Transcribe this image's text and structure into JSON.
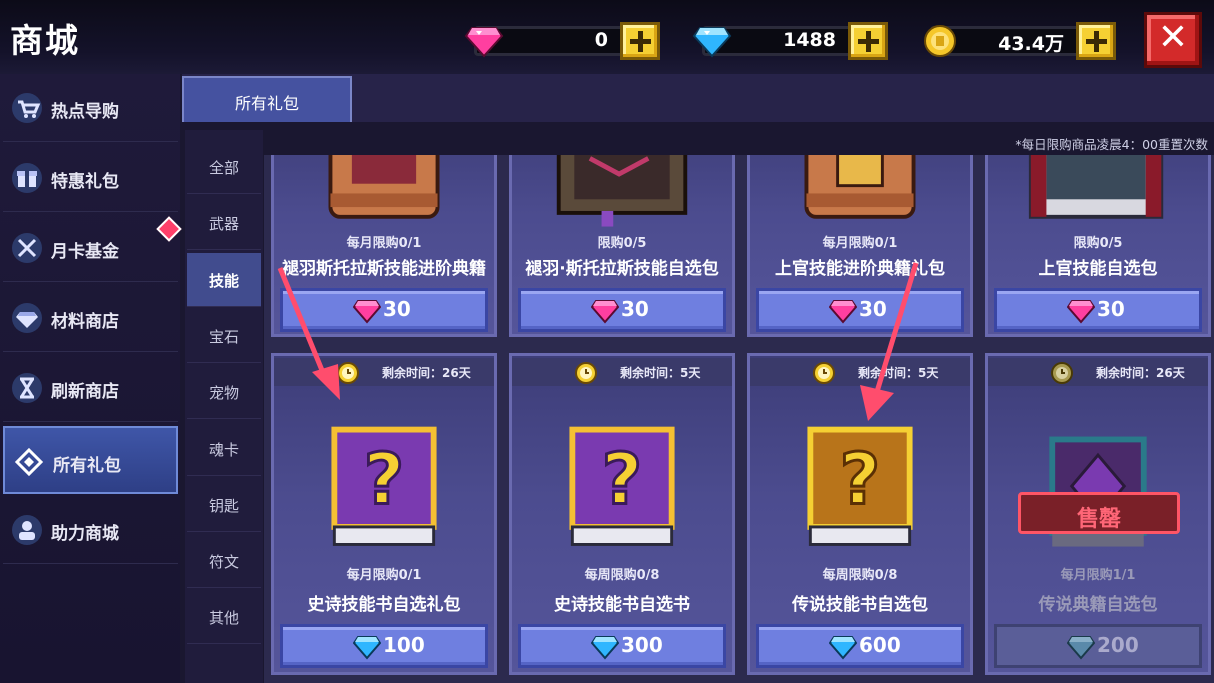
{
  "header": {
    "title": "商城",
    "currencies": [
      {
        "name": "pink-gem",
        "icon": "pink-gem-icon",
        "value": "0"
      },
      {
        "name": "blue-diamond",
        "icon": "blue-diamond-icon",
        "value": "1488"
      },
      {
        "name": "gold-coin",
        "icon": "gold-coin-icon",
        "value": "43.4万"
      }
    ]
  },
  "sidebar": {
    "items": [
      {
        "label": "热点导购",
        "icon": "cart-icon"
      },
      {
        "label": "特惠礼包",
        "icon": "gift-icon"
      },
      {
        "label": "月卡基金",
        "icon": "moon-card-icon"
      },
      {
        "label": "材料商店",
        "icon": "material-gem-icon"
      },
      {
        "label": "刷新商店",
        "icon": "hourglass-icon"
      },
      {
        "label": "所有礼包",
        "icon": "diamond-outline-icon",
        "active": true
      },
      {
        "label": "助力商城",
        "icon": "helper-icon"
      }
    ]
  },
  "tabs": [
    {
      "label": "所有礼包",
      "active": true
    }
  ],
  "notice": "*每日限购商品凌晨4：00重置次数",
  "categories": [
    {
      "label": "全部"
    },
    {
      "label": "武器"
    },
    {
      "label": "技能",
      "active": true
    },
    {
      "label": "宝石"
    },
    {
      "label": "宠物"
    },
    {
      "label": "魂卡"
    },
    {
      "label": "钥匙"
    },
    {
      "label": "符文"
    },
    {
      "label": "其他"
    }
  ],
  "products_row1": [
    {
      "limit": "每月限购0/1",
      "name": "褪羽斯托拉斯技能进阶典籍",
      "price": "30",
      "currency": "pink-gem"
    },
    {
      "limit": "限购0/5",
      "name": "褪羽·斯托拉斯技能自选包",
      "price": "30",
      "currency": "pink-gem"
    },
    {
      "limit": "每月限购0/1",
      "name": "上官技能进阶典籍礼包",
      "price": "30",
      "currency": "pink-gem"
    },
    {
      "limit": "限购0/5",
      "name": "上官技能自选包",
      "price": "30",
      "currency": "pink-gem"
    }
  ],
  "products_row2": [
    {
      "timer": "剩余时间：26天",
      "limit": "每月限购0/1",
      "name": "史诗技能书自选礼包",
      "price": "100",
      "currency": "blue-diamond"
    },
    {
      "timer": "剩余时间：5天",
      "limit": "每周限购0/8",
      "name": "史诗技能书自选书",
      "price": "300",
      "currency": "blue-diamond"
    },
    {
      "timer": "剩余时间：5天",
      "limit": "每周限购0/8",
      "name": "传说技能书自选包",
      "price": "600",
      "currency": "blue-diamond"
    },
    {
      "timer": "剩余时间：26天",
      "limit": "每月限购1/1",
      "name": "传说典籍自选包",
      "price": "200",
      "currency": "blue-diamond",
      "sold_out_label": "售罄"
    }
  ],
  "colors": {
    "accent": "#6f7fe0",
    "close": "#d32a2a",
    "arrow": "#ff4d6d"
  }
}
